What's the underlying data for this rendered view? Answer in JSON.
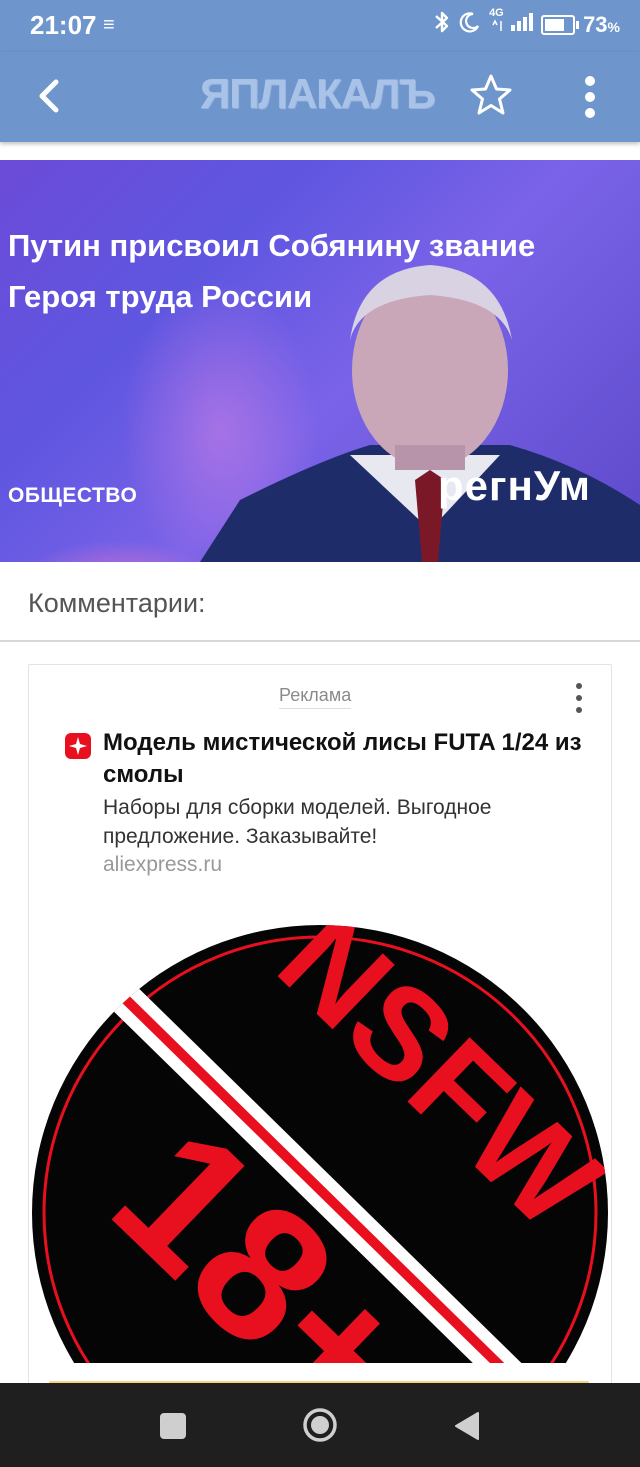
{
  "status_bar": {
    "time": "21:07",
    "menu_glyph": "≡",
    "network": "4G",
    "battery_percent": "73",
    "battery_unit": "%",
    "battery_level": 0.73
  },
  "app_bar": {
    "logo_text": "ЯПЛАКАЛЪ"
  },
  "banner": {
    "title_line1": "Путин присвоил Собянину звание",
    "title_line2": "Героя труда России",
    "category": "ОБЩЕСТВО",
    "brand": "регнУм"
  },
  "comments": {
    "title": "Комментарии:"
  },
  "ad": {
    "label": "Реклама",
    "title": "Модель мистической лисы FUTA 1/24 из смолы",
    "description": "Наборы для сборки моделей. Выгодное предложение. Заказывайте!",
    "domain": "aliexpress.ru",
    "image_text_top": "NSFW",
    "image_text_bottom": "18+",
    "colors": {
      "red": "#e8101e",
      "black": "#050505"
    }
  },
  "colors": {
    "appbar": "#6e96cc",
    "navbar": "#1f1f1f"
  },
  "icons": [
    "back-arrow-icon",
    "star-icon",
    "more-vert-icon",
    "bluetooth-icon",
    "moon-icon",
    "signal-icon",
    "battery-icon",
    "aliexpress-icon",
    "nav-square-icon",
    "nav-home-icon",
    "nav-back-icon"
  ]
}
